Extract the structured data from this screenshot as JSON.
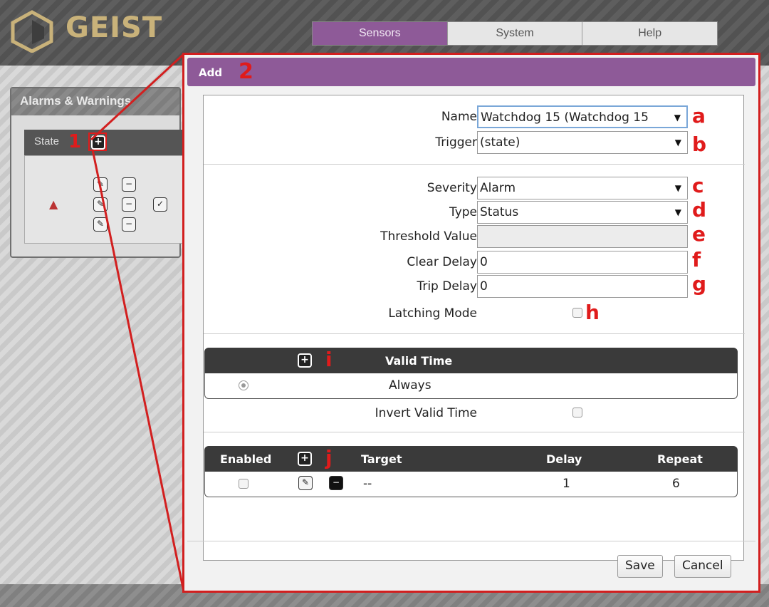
{
  "app": {
    "logo_text": "GEIST"
  },
  "nav": {
    "tabs": [
      {
        "label": "Sensors"
      },
      {
        "label": "System"
      },
      {
        "label": "Help"
      }
    ]
  },
  "left_panel": {
    "title": "Alarms & Warnings",
    "state_label": "State",
    "callout": "1"
  },
  "dialog": {
    "title": "Add",
    "callout": "2",
    "fields": {
      "name": {
        "label": "Name",
        "value": "Watchdog 15 (Watchdog 15",
        "callout": "a"
      },
      "trigger": {
        "label": "Trigger",
        "value": "(state)",
        "callout": "b"
      },
      "severity": {
        "label": "Severity",
        "value": "Alarm",
        "callout": "c"
      },
      "type": {
        "label": "Type",
        "value": "Status",
        "callout": "d"
      },
      "threshold": {
        "label": "Threshold Value",
        "value": "",
        "callout": "e"
      },
      "clear_delay": {
        "label": "Clear Delay",
        "value": "0",
        "callout": "f"
      },
      "trip_delay": {
        "label": "Trip Delay",
        "value": "0",
        "callout": "g"
      },
      "latching": {
        "label": "Latching Mode",
        "callout": "h"
      }
    },
    "valid_time": {
      "header": "Valid Time",
      "callout": "i",
      "row": "Always",
      "invert_label": "Invert Valid Time"
    },
    "actions": {
      "callout": "j",
      "columns": {
        "enabled": "Enabled",
        "target": "Target",
        "delay": "Delay",
        "repeat": "Repeat"
      },
      "row": {
        "target": "--",
        "delay": "1",
        "repeat": "6"
      }
    },
    "buttons": {
      "save": "Save",
      "cancel": "Cancel"
    }
  },
  "colors": {
    "accent": "#8e5a98",
    "callout": "#e01b1b"
  }
}
